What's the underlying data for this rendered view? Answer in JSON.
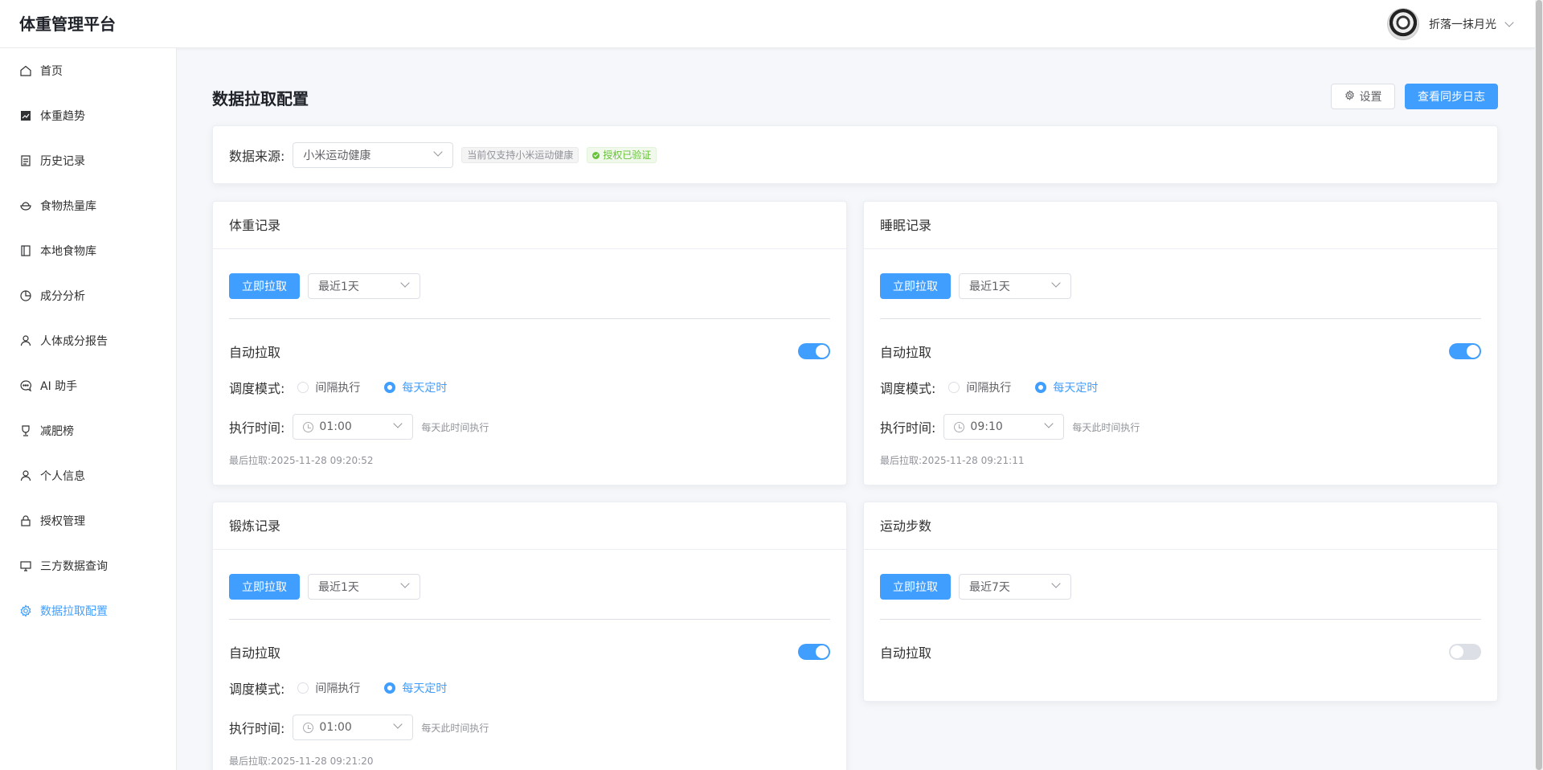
{
  "header": {
    "brand": "体重管理平台",
    "username": "折落一抹月光"
  },
  "sidebar": {
    "items": [
      {
        "label": "首页",
        "icon": "home-icon"
      },
      {
        "label": "体重趋势",
        "icon": "trend-chart-icon"
      },
      {
        "label": "历史记录",
        "icon": "document-icon"
      },
      {
        "label": "食物热量库",
        "icon": "bowl-icon"
      },
      {
        "label": "本地食物库",
        "icon": "notebook-icon"
      },
      {
        "label": "成分分析",
        "icon": "pie-chart-icon"
      },
      {
        "label": "人体成分报告",
        "icon": "user-icon"
      },
      {
        "label": "AI 助手",
        "icon": "chat-icon"
      },
      {
        "label": "减肥榜",
        "icon": "trophy-icon"
      },
      {
        "label": "个人信息",
        "icon": "user-icon"
      },
      {
        "label": "授权管理",
        "icon": "lock-icon"
      },
      {
        "label": "三方数据查询",
        "icon": "monitor-icon"
      },
      {
        "label": "数据拉取配置",
        "icon": "gear-icon",
        "active": true
      }
    ]
  },
  "page": {
    "title": "数据拉取配置",
    "settings_label": "设置",
    "sync_log_label": "查看同步日志"
  },
  "source": {
    "label": "数据来源:",
    "value": "小米运动健康",
    "note": "当前仅支持小米运动健康",
    "auth_status": "授权已验证"
  },
  "common": {
    "pull_now": "立即拉取",
    "auto_pull": "自动拉取",
    "mode_label": "调度模式:",
    "mode_interval": "间隔执行",
    "mode_daily": "每天定时",
    "time_label": "执行时间:",
    "time_hint": "每天此时间执行",
    "last_prefix": "最后拉取:"
  },
  "panels": [
    {
      "title": "体重记录",
      "range": "最近1天",
      "auto": true,
      "time": "01:00",
      "last": "2025-11-28 09:20:52"
    },
    {
      "title": "睡眠记录",
      "range": "最近1天",
      "auto": true,
      "time": "09:10",
      "last": "2025-11-28 09:21:11"
    },
    {
      "title": "锻炼记录",
      "range": "最近1天",
      "auto": true,
      "time": "01:00",
      "last": "2025-11-28 09:21:20"
    },
    {
      "title": "运动步数",
      "range": "最近7天",
      "auto": false
    }
  ],
  "colors": {
    "primary": "#409eff",
    "success": "#67c23a"
  }
}
